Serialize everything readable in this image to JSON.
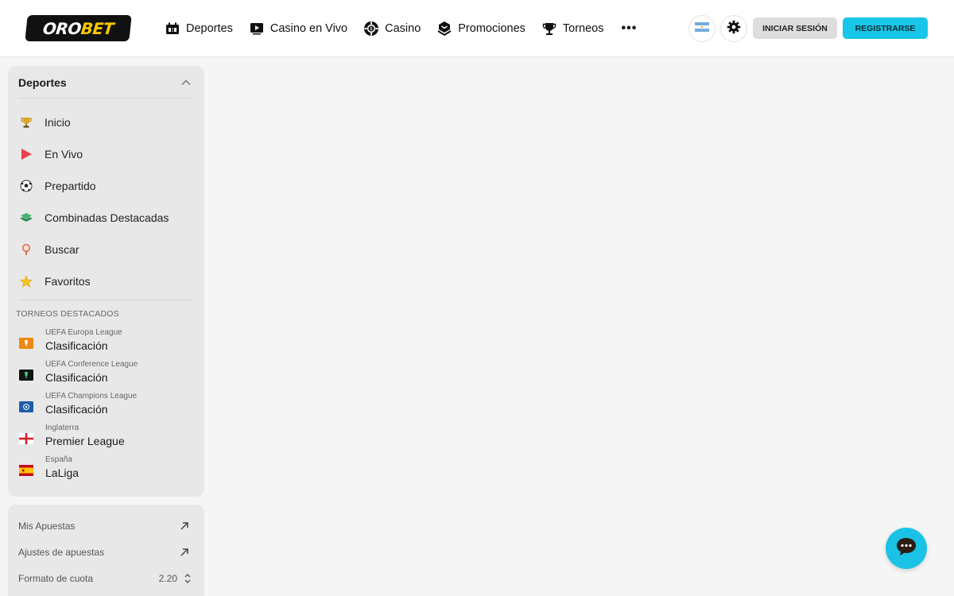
{
  "header": {
    "logo_prefix": "ORO",
    "logo_suffix": "BET",
    "nav": [
      {
        "label": "Deportes",
        "icon": "scoreboard-icon"
      },
      {
        "label": "Casino en Vivo",
        "icon": "play-screen-icon"
      },
      {
        "label": "Casino",
        "icon": "casino-chip-icon"
      },
      {
        "label": "Promociones",
        "icon": "gift-box-icon"
      },
      {
        "label": "Torneos",
        "icon": "trophy-icon"
      }
    ],
    "more_label": "•••",
    "login_label": "INICIAR SESIÓN",
    "register_label": "REGISTRARSE",
    "colors": {
      "accent": "#17c6e8",
      "logo_accent": "#f6c700"
    }
  },
  "sidebar": {
    "sports": {
      "title": "Deportes",
      "items": [
        {
          "label": "Inicio",
          "icon": "trophy-icon"
        },
        {
          "label": "En Vivo",
          "icon": "live-play-icon"
        },
        {
          "label": "Prepartido",
          "icon": "soccer-ball-icon"
        },
        {
          "label": "Combinadas Destacadas",
          "icon": "layers-icon"
        },
        {
          "label": "Buscar",
          "icon": "search-icon"
        },
        {
          "label": "Favoritos",
          "icon": "star-icon"
        }
      ],
      "featured_label": "TORNEOS DESTACADOS",
      "tournaments": [
        {
          "sub": "UEFA Europa League",
          "main": "Clasificación",
          "icon": "europa-league-icon"
        },
        {
          "sub": "UEFA Conference League",
          "main": "Clasificación",
          "icon": "conference-league-icon"
        },
        {
          "sub": "UEFA Champions League",
          "main": "Clasificación",
          "icon": "champions-league-icon"
        },
        {
          "sub": "Inglaterra",
          "main": "Premier League",
          "icon": "england-flag-icon"
        },
        {
          "sub": "España",
          "main": "LaLiga",
          "icon": "spain-flag-icon"
        }
      ]
    },
    "settings": {
      "my_bets": "Mis Apuestas",
      "bet_settings": "Ajustes de apuestas",
      "odds_format_label": "Formato de cuota",
      "odds_format_value": "2.20"
    }
  }
}
